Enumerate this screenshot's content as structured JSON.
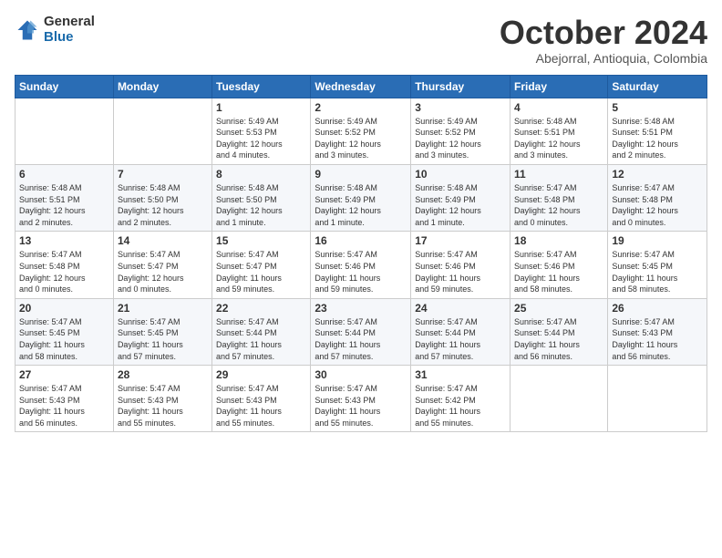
{
  "logo": {
    "general": "General",
    "blue": "Blue"
  },
  "header": {
    "month": "October 2024",
    "location": "Abejorral, Antioquia, Colombia"
  },
  "weekdays": [
    "Sunday",
    "Monday",
    "Tuesday",
    "Wednesday",
    "Thursday",
    "Friday",
    "Saturday"
  ],
  "weeks": [
    [
      {
        "day": "",
        "info": ""
      },
      {
        "day": "",
        "info": ""
      },
      {
        "day": "1",
        "info": "Sunrise: 5:49 AM\nSunset: 5:53 PM\nDaylight: 12 hours\nand 4 minutes."
      },
      {
        "day": "2",
        "info": "Sunrise: 5:49 AM\nSunset: 5:52 PM\nDaylight: 12 hours\nand 3 minutes."
      },
      {
        "day": "3",
        "info": "Sunrise: 5:49 AM\nSunset: 5:52 PM\nDaylight: 12 hours\nand 3 minutes."
      },
      {
        "day": "4",
        "info": "Sunrise: 5:48 AM\nSunset: 5:51 PM\nDaylight: 12 hours\nand 3 minutes."
      },
      {
        "day": "5",
        "info": "Sunrise: 5:48 AM\nSunset: 5:51 PM\nDaylight: 12 hours\nand 2 minutes."
      }
    ],
    [
      {
        "day": "6",
        "info": "Sunrise: 5:48 AM\nSunset: 5:51 PM\nDaylight: 12 hours\nand 2 minutes."
      },
      {
        "day": "7",
        "info": "Sunrise: 5:48 AM\nSunset: 5:50 PM\nDaylight: 12 hours\nand 2 minutes."
      },
      {
        "day": "8",
        "info": "Sunrise: 5:48 AM\nSunset: 5:50 PM\nDaylight: 12 hours\nand 1 minute."
      },
      {
        "day": "9",
        "info": "Sunrise: 5:48 AM\nSunset: 5:49 PM\nDaylight: 12 hours\nand 1 minute."
      },
      {
        "day": "10",
        "info": "Sunrise: 5:48 AM\nSunset: 5:49 PM\nDaylight: 12 hours\nand 1 minute."
      },
      {
        "day": "11",
        "info": "Sunrise: 5:47 AM\nSunset: 5:48 PM\nDaylight: 12 hours\nand 0 minutes."
      },
      {
        "day": "12",
        "info": "Sunrise: 5:47 AM\nSunset: 5:48 PM\nDaylight: 12 hours\nand 0 minutes."
      }
    ],
    [
      {
        "day": "13",
        "info": "Sunrise: 5:47 AM\nSunset: 5:48 PM\nDaylight: 12 hours\nand 0 minutes."
      },
      {
        "day": "14",
        "info": "Sunrise: 5:47 AM\nSunset: 5:47 PM\nDaylight: 12 hours\nand 0 minutes."
      },
      {
        "day": "15",
        "info": "Sunrise: 5:47 AM\nSunset: 5:47 PM\nDaylight: 11 hours\nand 59 minutes."
      },
      {
        "day": "16",
        "info": "Sunrise: 5:47 AM\nSunset: 5:46 PM\nDaylight: 11 hours\nand 59 minutes."
      },
      {
        "day": "17",
        "info": "Sunrise: 5:47 AM\nSunset: 5:46 PM\nDaylight: 11 hours\nand 59 minutes."
      },
      {
        "day": "18",
        "info": "Sunrise: 5:47 AM\nSunset: 5:46 PM\nDaylight: 11 hours\nand 58 minutes."
      },
      {
        "day": "19",
        "info": "Sunrise: 5:47 AM\nSunset: 5:45 PM\nDaylight: 11 hours\nand 58 minutes."
      }
    ],
    [
      {
        "day": "20",
        "info": "Sunrise: 5:47 AM\nSunset: 5:45 PM\nDaylight: 11 hours\nand 58 minutes."
      },
      {
        "day": "21",
        "info": "Sunrise: 5:47 AM\nSunset: 5:45 PM\nDaylight: 11 hours\nand 57 minutes."
      },
      {
        "day": "22",
        "info": "Sunrise: 5:47 AM\nSunset: 5:44 PM\nDaylight: 11 hours\nand 57 minutes."
      },
      {
        "day": "23",
        "info": "Sunrise: 5:47 AM\nSunset: 5:44 PM\nDaylight: 11 hours\nand 57 minutes."
      },
      {
        "day": "24",
        "info": "Sunrise: 5:47 AM\nSunset: 5:44 PM\nDaylight: 11 hours\nand 57 minutes."
      },
      {
        "day": "25",
        "info": "Sunrise: 5:47 AM\nSunset: 5:44 PM\nDaylight: 11 hours\nand 56 minutes."
      },
      {
        "day": "26",
        "info": "Sunrise: 5:47 AM\nSunset: 5:43 PM\nDaylight: 11 hours\nand 56 minutes."
      }
    ],
    [
      {
        "day": "27",
        "info": "Sunrise: 5:47 AM\nSunset: 5:43 PM\nDaylight: 11 hours\nand 56 minutes."
      },
      {
        "day": "28",
        "info": "Sunrise: 5:47 AM\nSunset: 5:43 PM\nDaylight: 11 hours\nand 55 minutes."
      },
      {
        "day": "29",
        "info": "Sunrise: 5:47 AM\nSunset: 5:43 PM\nDaylight: 11 hours\nand 55 minutes."
      },
      {
        "day": "30",
        "info": "Sunrise: 5:47 AM\nSunset: 5:43 PM\nDaylight: 11 hours\nand 55 minutes."
      },
      {
        "day": "31",
        "info": "Sunrise: 5:47 AM\nSunset: 5:42 PM\nDaylight: 11 hours\nand 55 minutes."
      },
      {
        "day": "",
        "info": ""
      },
      {
        "day": "",
        "info": ""
      }
    ]
  ]
}
